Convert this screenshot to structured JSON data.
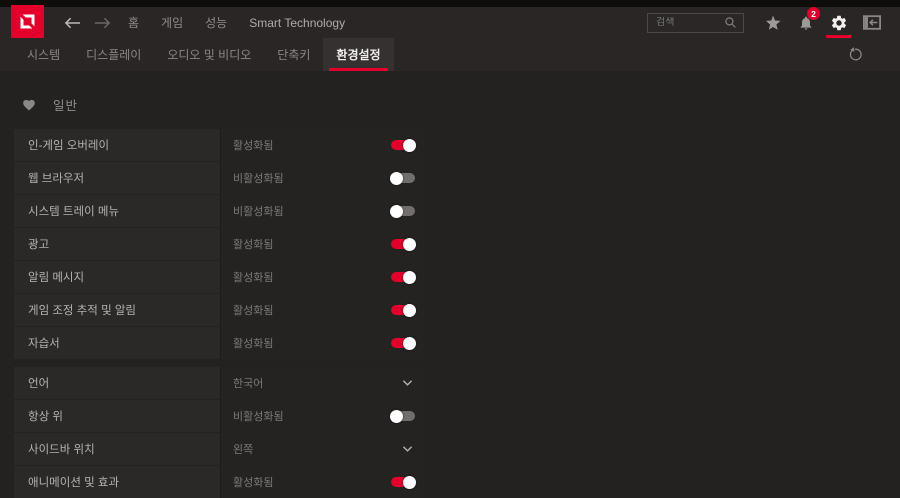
{
  "navbar": {
    "menu_items": [
      {
        "label": "홈",
        "highlight": false
      },
      {
        "label": "게임",
        "highlight": false
      },
      {
        "label": "성능",
        "highlight": false
      },
      {
        "label": "Smart Technology",
        "highlight": true
      }
    ],
    "search": {
      "placeholder": "검색",
      "value": ""
    },
    "notifications": {
      "badge_count": "2"
    }
  },
  "tabbar": {
    "tabs": [
      {
        "label": "시스템",
        "active": false
      },
      {
        "label": "디스플레이",
        "active": false
      },
      {
        "label": "오디오 및 비디오",
        "active": false
      },
      {
        "label": "단축키",
        "active": false
      },
      {
        "label": "환경설정",
        "active": true
      }
    ]
  },
  "content": {
    "section_title": "일반",
    "groups": [
      {
        "rows": [
          {
            "label": "인-게임 오버레이",
            "value": "활성화됨",
            "control": "toggle",
            "state": "on"
          },
          {
            "label": "웹 브라우저",
            "value": "비활성화됨",
            "control": "toggle",
            "state": "off"
          },
          {
            "label": "시스템 트레이 메뉴",
            "value": "비활성화됨",
            "control": "toggle",
            "state": "off"
          },
          {
            "label": "광고",
            "value": "활성화됨",
            "control": "toggle",
            "state": "on"
          },
          {
            "label": "알림 메시지",
            "value": "활성화됨",
            "control": "toggle",
            "state": "on"
          },
          {
            "label": "게임 조정 추적 및 알림",
            "value": "활성화됨",
            "control": "toggle",
            "state": "on"
          },
          {
            "label": "자습서",
            "value": "활성화됨",
            "control": "toggle",
            "state": "on"
          }
        ]
      },
      {
        "rows": [
          {
            "label": "언어",
            "value": "한국어",
            "control": "dropdown"
          },
          {
            "label": "항상 위",
            "value": "비활성화됨",
            "control": "toggle",
            "state": "off"
          },
          {
            "label": "사이드바 위치",
            "value": "왼쪽",
            "control": "dropdown"
          },
          {
            "label": "애니메이션 및 효과",
            "value": "활성화됨",
            "control": "toggle",
            "state": "on"
          }
        ]
      }
    ]
  },
  "icons": {
    "logo": "amd-logo",
    "back": "back-arrow-icon",
    "forward": "forward-arrow-icon",
    "search": "search-icon",
    "favorites": "star-icon",
    "alerts": "bell-icon",
    "settings": "gear-icon",
    "dock": "pin-sidebar-icon",
    "reset": "undo-icon",
    "section": "heart-icon",
    "dropdown": "chevron-down-icon"
  },
  "colors": {
    "accent": "#e4002b",
    "toggle_off": "#716e6c",
    "bar_background": "#292625",
    "row_label_background": "#2b2828",
    "page_background": "#242121"
  }
}
